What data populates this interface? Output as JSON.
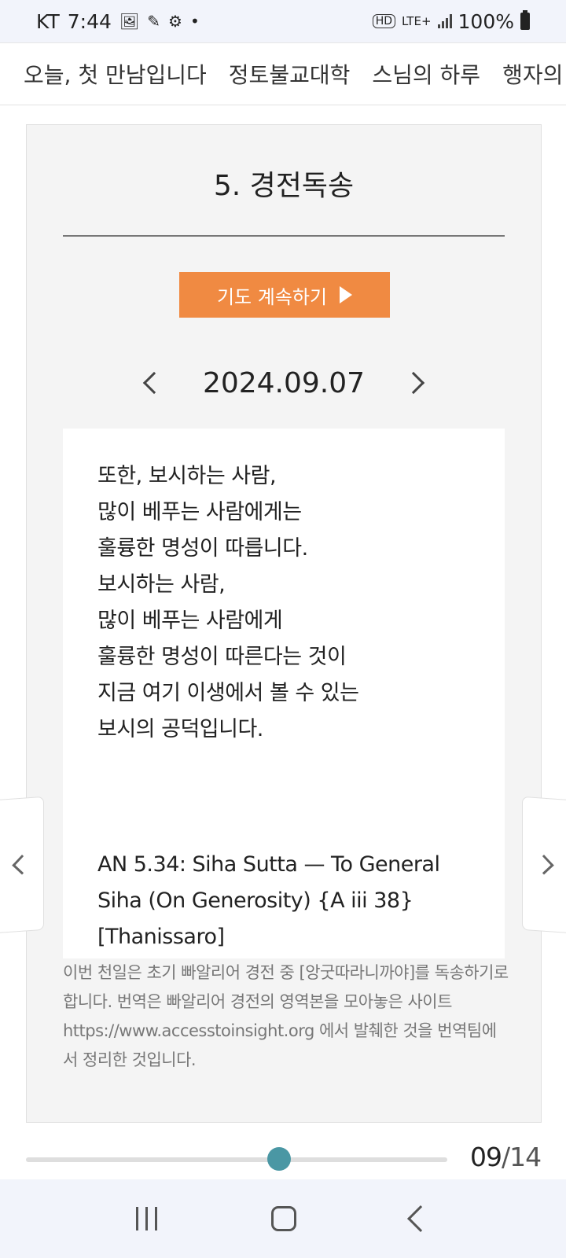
{
  "status_bar": {
    "carrier": "KT",
    "time": "7:44",
    "network": "LTE+",
    "battery": "100%"
  },
  "top_nav": {
    "items": [
      "오늘, 첫 만남입니다",
      "정토불교대학",
      "스님의 하루",
      "행자의 하루"
    ]
  },
  "card": {
    "title": "5. 경전독송",
    "continue_button": "기도 계속하기",
    "date": "2024.09.07",
    "verse_lines": [
      "또한, 보시하는 사람,",
      "많이 베푸는 사람에게는",
      "훌륭한 명성이 따릅니다.",
      "보시하는 사람,",
      "많이 베푸는 사람에게",
      "훌륭한 명성이 따른다는 것이",
      "지금 여기 이생에서 볼 수 있는",
      "보시의 공덕입니다."
    ],
    "source": "AN 5.34: Siha Sutta — To General Siha (On Generosity) {A iii 38} [Thanissaro]",
    "note": "이번 천일은 초기 빠알리어 경전 중 [앙굿따라니까야]를 독송하기로 합니다. 번역은 빠알리어 경전의 영역본을 모아놓은 사이트 https://www.accesstoinsight.org 에서 발췌한 것을 번역팀에서 정리한 것입니다."
  },
  "pager": {
    "current": "09",
    "total": "14",
    "progress": 0.6
  },
  "colors": {
    "accent_orange": "#f08a42",
    "slider_knob": "#4a97a4"
  }
}
